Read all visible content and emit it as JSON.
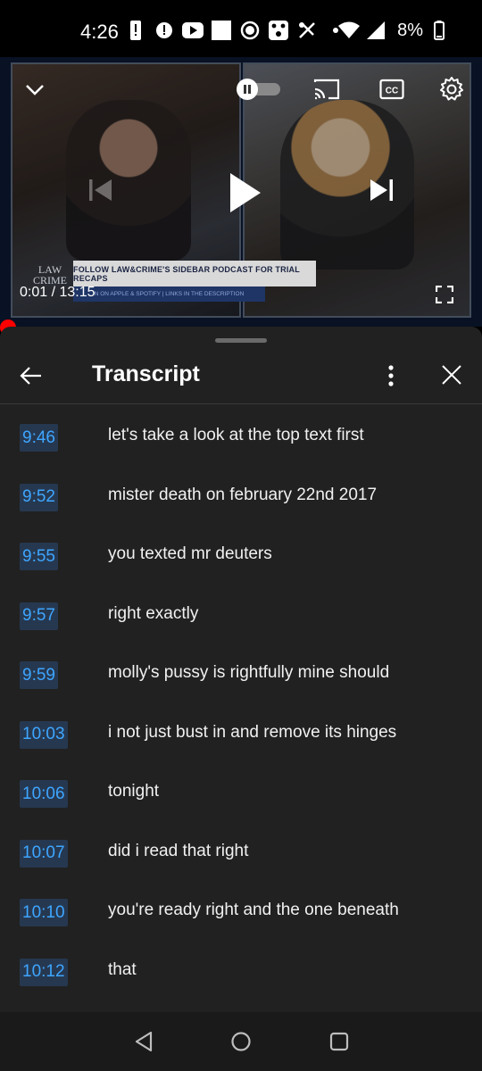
{
  "status_bar": {
    "time": "4:26",
    "battery_percent": "8%"
  },
  "video": {
    "current_time": "0:01",
    "separator": " / ",
    "duration": "13:15",
    "logo_line1": "LAW",
    "logo_line2": "CRIME",
    "banner_text": "FOLLOW LAW&CRIME'S SIDEBAR PODCAST FOR TRIAL RECAPS",
    "banner_subtext": "N ON APPLE & SPOTIFY | LINKS IN THE DESCRIPTION",
    "autoplay_on": false
  },
  "transcript": {
    "title": "Transcript",
    "lines": [
      {
        "time": "9:46",
        "text": "let's take a look at the top text first"
      },
      {
        "time": "9:52",
        "text": "mister death on february 22nd 2017"
      },
      {
        "time": "9:55",
        "text": "you texted mr deuters"
      },
      {
        "time": "9:57",
        "text": "right exactly"
      },
      {
        "time": "9:59",
        "text": "molly's pussy is rightfully mine should"
      },
      {
        "time": "10:03",
        "text": "i not just bust in and remove its hinges"
      },
      {
        "time": "10:06",
        "text": "tonight"
      },
      {
        "time": "10:07",
        "text": "did i read that right"
      },
      {
        "time": "10:10",
        "text": "you're ready right and the one beneath"
      },
      {
        "time": "10:12",
        "text": "that"
      }
    ]
  },
  "colors": {
    "accent_blue": "#3ea6ff",
    "progress_red": "#ff0000",
    "sheet_bg": "#212121"
  }
}
